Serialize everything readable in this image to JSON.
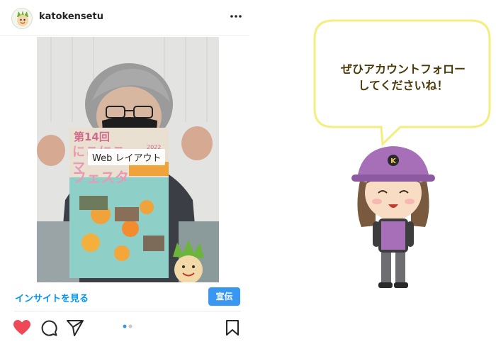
{
  "post": {
    "username": "katokensetu",
    "photo_overlay_label": "Web レイアウト",
    "insight_link": "インサイトを見る",
    "promote_button": "宣伝",
    "carousel": {
      "current": 1,
      "total": 2
    }
  },
  "poster": {
    "title_line1": "第14回",
    "title_line2": "にこにこ",
    "title_line3": "マ",
    "title_line4": "フェスタ",
    "year": "2022"
  },
  "speech": {
    "line1": "ぜひアカウントフォロー",
    "line2": "してくださいね！"
  },
  "colors": {
    "accent_blue": "#0095f6",
    "button_blue": "#3897f0",
    "like_red": "#ed4956",
    "bubble_fill": "#ffffff",
    "bubble_border": "#f5f08c",
    "helmet_purple": "#a66fb7"
  },
  "icons": [
    "more-icon",
    "heart-icon",
    "comment-icon",
    "share-icon",
    "bookmark-icon",
    "carousel-dots"
  ]
}
